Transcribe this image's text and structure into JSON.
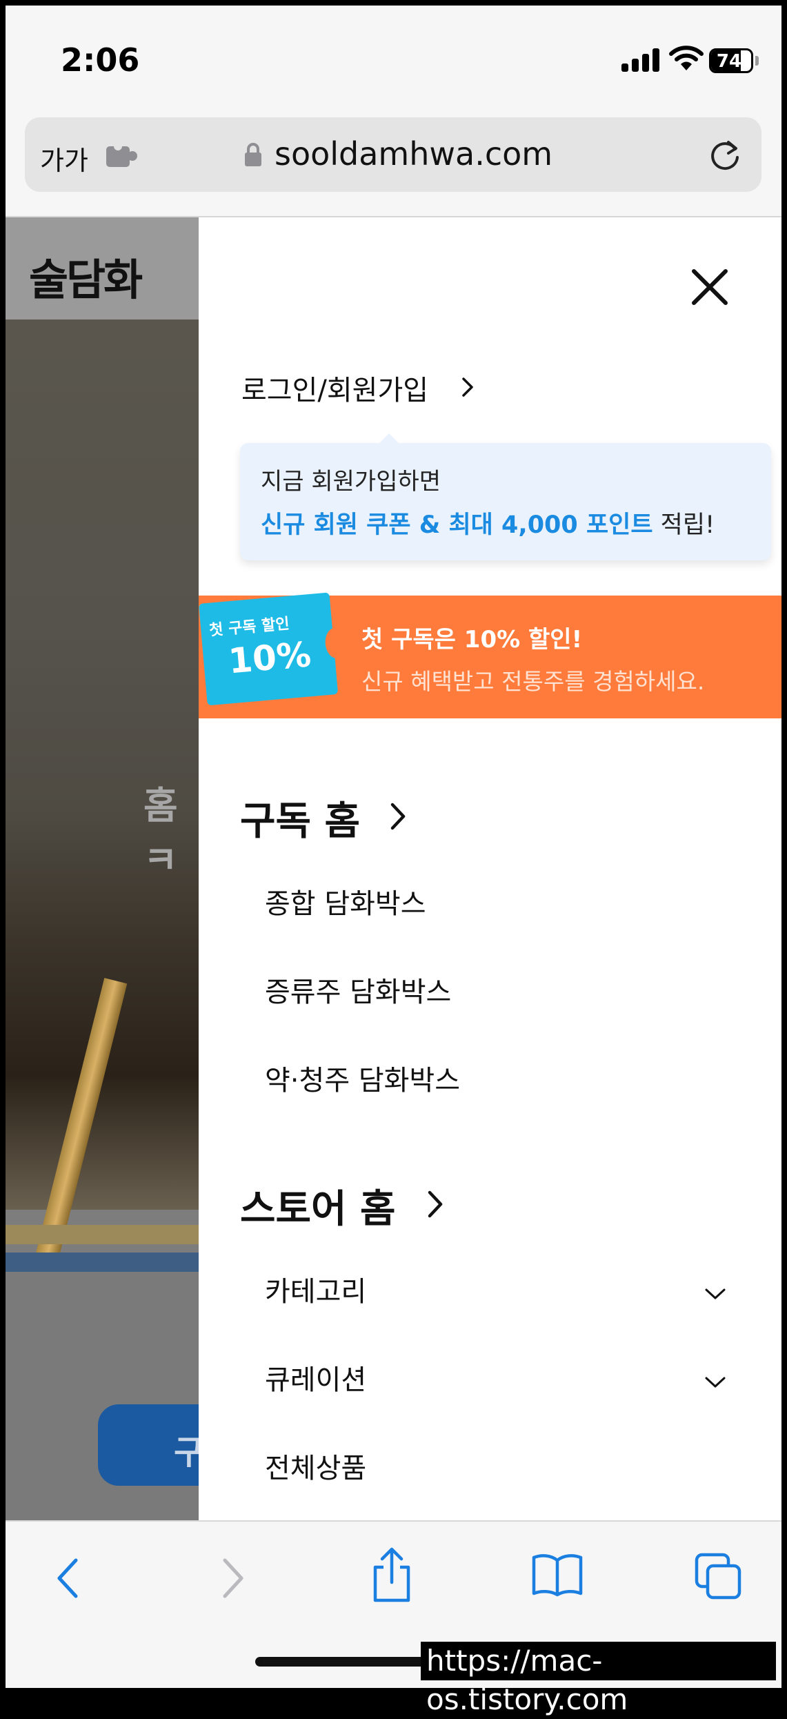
{
  "status_bar": {
    "time": "2:06",
    "battery": "74",
    "battery_level": 0.74
  },
  "browser": {
    "text_size_label": "가가",
    "url": "sooldamhwa.com"
  },
  "background_page": {
    "logo": "술담화",
    "hero_text": "홈ㅋ",
    "button_text": "구"
  },
  "drawer": {
    "login_label": "로그인/회원가입",
    "tooltip": {
      "line1": "지금 회원가입하면",
      "line2_highlight": "신규 회원 쿠폰 & 최대 4,000 포인트",
      "line2_rest": " 적립!"
    },
    "promo": {
      "ticket_label": "첫 구독 할인",
      "ticket_value": "10%",
      "title": "첫 구독은 10% 할인!",
      "subtitle": "신규 혜택받고 전통주를 경험하세요."
    },
    "subscription": {
      "title": "구독 홈",
      "items": [
        "종합 담화박스",
        "증류주 담화박스",
        "약·청주 담화박스"
      ]
    },
    "store": {
      "title": "스토어 홈",
      "items": [
        {
          "label": "카테고리",
          "expandable": true
        },
        {
          "label": "큐레이션",
          "expandable": true
        },
        {
          "label": "전체상품",
          "expandable": false
        }
      ]
    }
  },
  "toolbar": {
    "icons": [
      "back-icon",
      "forward-icon",
      "share-icon",
      "bookmarks-icon",
      "tabs-icon"
    ],
    "accent_color": "#1a7fe0"
  },
  "watermark": "https://mac-os.tistory.com"
}
